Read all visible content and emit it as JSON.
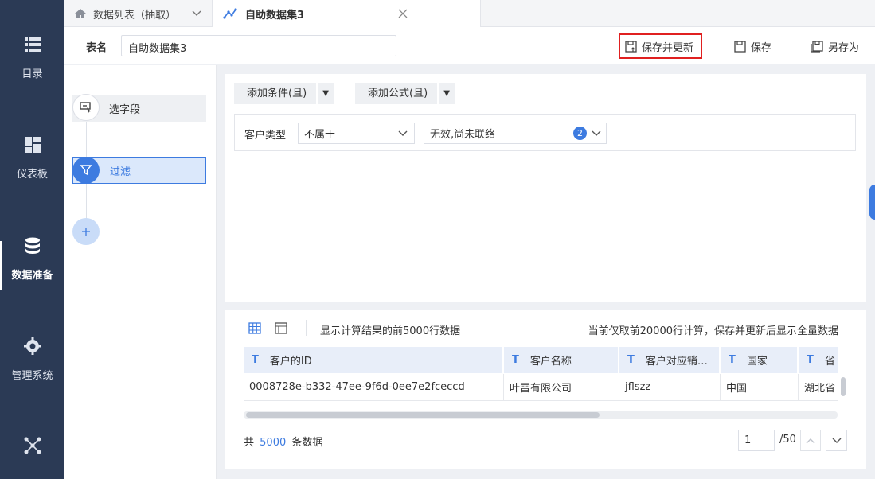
{
  "sidebar": {
    "items": [
      {
        "label": "目录",
        "icon": "list-icon"
      },
      {
        "label": "仪表板",
        "icon": "dashboard-icon"
      },
      {
        "label": "数据准备",
        "icon": "database-icon",
        "active": true
      },
      {
        "label": "管理系统",
        "icon": "gear-icon"
      },
      {
        "label": "",
        "icon": "network-icon"
      }
    ]
  },
  "tabs": [
    {
      "label": "数据列表（抽取）",
      "icon": "home-icon"
    },
    {
      "label": "自助数据集3",
      "icon": "dataset-icon"
    }
  ],
  "header": {
    "table_name_label": "表名",
    "table_name_value": "自助数据集3",
    "save_update": "保存并更新",
    "save": "保存",
    "save_as": "另存为"
  },
  "steps": [
    {
      "label": "选字段"
    },
    {
      "label": "过滤"
    }
  ],
  "filter": {
    "add_condition": "添加条件(且)",
    "add_formula": "添加公式(且)",
    "field": "客户类型",
    "operator": "不属于",
    "value": "无效,尚未联络",
    "value_count": "2"
  },
  "preview": {
    "info_left": "显示计算结果的前5000行数据",
    "info_right": "当前仅取前20000行计算，保存并更新后显示全量数据",
    "columns": [
      "客户的ID",
      "客户名称",
      "客户对应销…",
      "国家",
      "省"
    ],
    "row": [
      "0008728e-b332-47ee-9f6d-0ee7e2fceccd",
      "叶雷有限公司",
      "jflszz",
      "中国",
      "湖北省"
    ],
    "total_prefix": "共",
    "total_count": "5000",
    "total_suffix": "条数据",
    "page": "1",
    "page_total": "/50"
  },
  "colors": {
    "accent": "#3d7be0",
    "sidebar": "#2b3a55",
    "highlight_border": "#e02020"
  }
}
